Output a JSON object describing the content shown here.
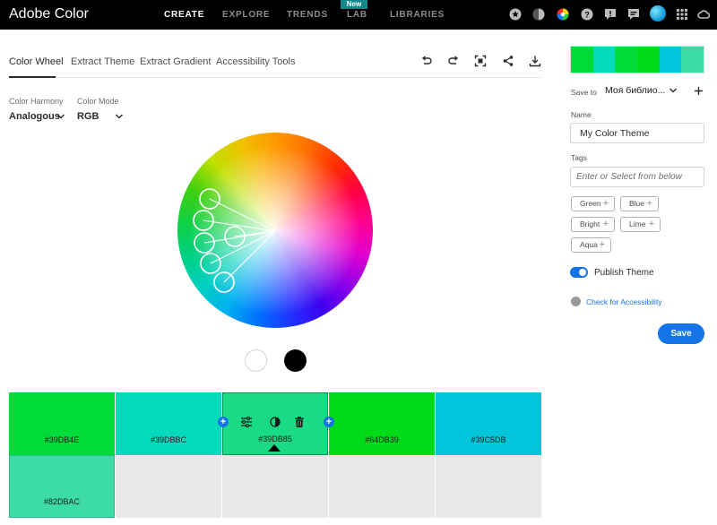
{
  "app": {
    "title": "Adobe Color"
  },
  "nav": {
    "items": [
      {
        "label": "CREATE",
        "active": true
      },
      {
        "label": "EXPLORE",
        "active": false
      },
      {
        "label": "TRENDS",
        "active": false
      },
      {
        "label": "LAB",
        "active": false
      },
      {
        "label": "LIBRARIES",
        "active": false
      }
    ],
    "lab_badge": "New",
    "icons": [
      "star-icon",
      "contrast-icon",
      "color-wheel-icon",
      "help-icon",
      "alert-icon",
      "chat-icon",
      "avatar",
      "apps-grid-icon",
      "creative-cloud-icon"
    ]
  },
  "tabs": [
    {
      "label": "Color Wheel",
      "active": true
    },
    {
      "label": "Extract Theme",
      "active": false
    },
    {
      "label": "Extract Gradient",
      "active": false
    },
    {
      "label": "Accessibility Tools",
      "active": false
    }
  ],
  "controls": {
    "harmony_label": "Color Harmony",
    "harmony_value": "Analogous",
    "mode_label": "Color Mode",
    "mode_value": "RGB"
  },
  "swatches": [
    {
      "hex": "#39DB4E",
      "color": "#00DB3A"
    },
    {
      "hex": "#39DBBC",
      "color": "#05DBBC"
    },
    {
      "hex": "#39DB85",
      "color": "#1ADB85",
      "selected": true
    },
    {
      "hex": "#64DB39",
      "color": "#00DB18"
    },
    {
      "hex": "#39C5DB",
      "color": "#00C5DB"
    }
  ],
  "swatch_row2": [
    {
      "hex": "#82DBAC",
      "color": "#3CDBA8"
    }
  ],
  "right": {
    "palette": [
      "#00DB3A",
      "#05DBBC",
      "#00DB18",
      "#00DB18",
      "#00C5DB",
      "#3CDBA8"
    ],
    "save_to_label": "Save to",
    "save_to_value": "Моя библио...",
    "name_label": "Name",
    "name_value": "My Color Theme",
    "tags_label": "Tags",
    "tags_placeholder": "Enter or Select from below",
    "tags": [
      "Green",
      "Blue",
      "Bright",
      "Lime",
      "Aqua"
    ],
    "publish_label": "Publish Theme",
    "publish_on": true,
    "accessibility_label": "Check for Accessibility",
    "save_label": "Save",
    "accent": "#1473E6"
  }
}
